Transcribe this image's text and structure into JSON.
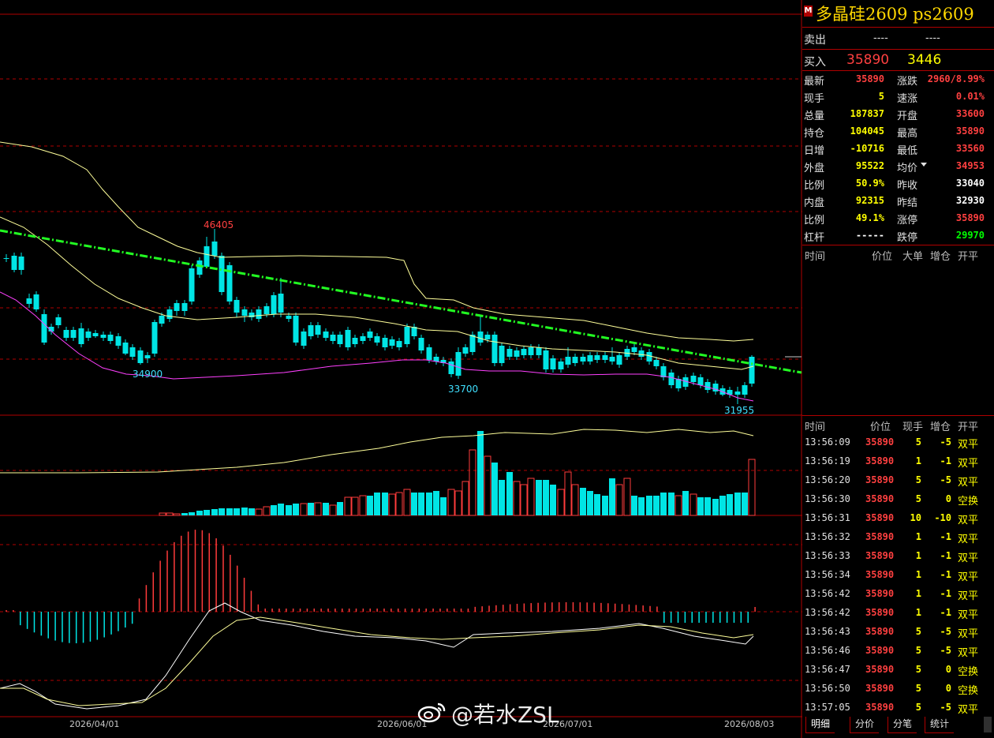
{
  "instrument": {
    "badge": "M",
    "title": "多晶硅2609  ps2609"
  },
  "orderbook": {
    "sell_label": "卖出",
    "sell_price": "----",
    "sell_vol": "----",
    "buy_label": "买入",
    "buy_price": "35890",
    "buy_vol": "3446"
  },
  "quote_left": [
    {
      "label": "最新",
      "value": "35890",
      "color": "#ff4040"
    },
    {
      "label": "现手",
      "value": "5",
      "color": "#ffff00"
    },
    {
      "label": "总量",
      "value": "187837",
      "color": "#ffff00"
    },
    {
      "label": "持仓",
      "value": "104045",
      "color": "#ffff00"
    },
    {
      "label": "日增",
      "value": "-10716",
      "color": "#ffff00"
    },
    {
      "label": "外盘",
      "value": "95522",
      "color": "#ffff00"
    },
    {
      "label": "比例",
      "value": "50.9%",
      "color": "#ffff00"
    },
    {
      "label": "内盘",
      "value": "92315",
      "color": "#ffff00"
    },
    {
      "label": "比例",
      "value": "49.1%",
      "color": "#ffff00"
    },
    {
      "label": "杠杆",
      "value": "-----",
      "color": "#ffffff"
    }
  ],
  "quote_right": [
    {
      "label": "涨跌",
      "value": "2960/8.99%",
      "color": "#ff4040"
    },
    {
      "label": "速涨",
      "value": "0.01%",
      "color": "#ff4040"
    },
    {
      "label": "开盘",
      "value": "33600",
      "color": "#ff4040"
    },
    {
      "label": "最高",
      "value": "35890",
      "color": "#ff4040"
    },
    {
      "label": "最低",
      "value": "33560",
      "color": "#ff4040"
    },
    {
      "label": "均价",
      "value": "34953",
      "color": "#ff4040"
    },
    {
      "label": "昨收",
      "value": "33040",
      "color": "#ffffff"
    },
    {
      "label": "昨结",
      "value": "32930",
      "color": "#ffffff"
    },
    {
      "label": "涨停",
      "value": "35890",
      "color": "#ff4040"
    },
    {
      "label": "跌停",
      "value": "29970",
      "color": "#00ff00"
    }
  ],
  "big_order_headers": [
    "时间",
    "价位",
    "大单",
    "增仓",
    "开平"
  ],
  "tick_headers": [
    "时间",
    "价位",
    "现手",
    "增仓",
    "开平"
  ],
  "ticks": [
    {
      "time": "13:56:09",
      "price": "35890",
      "vol": "5",
      "oi": "-5",
      "type": "双平"
    },
    {
      "time": "13:56:19",
      "price": "35890",
      "vol": "1",
      "oi": "-1",
      "type": "双平"
    },
    {
      "time": "13:56:20",
      "price": "35890",
      "vol": "5",
      "oi": "-5",
      "type": "双平"
    },
    {
      "time": "13:56:30",
      "price": "35890",
      "vol": "5",
      "oi": "0",
      "type": "空换"
    },
    {
      "time": "13:56:31",
      "price": "35890",
      "vol": "10",
      "oi": "-10",
      "type": "双平"
    },
    {
      "time": "13:56:32",
      "price": "35890",
      "vol": "1",
      "oi": "-1",
      "type": "双平"
    },
    {
      "time": "13:56:33",
      "price": "35890",
      "vol": "1",
      "oi": "-1",
      "type": "双平"
    },
    {
      "time": "13:56:34",
      "price": "35890",
      "vol": "1",
      "oi": "-1",
      "type": "双平"
    },
    {
      "time": "13:56:42",
      "price": "35890",
      "vol": "1",
      "oi": "-1",
      "type": "双平"
    },
    {
      "time": "13:56:42",
      "price": "35890",
      "vol": "1",
      "oi": "-1",
      "type": "双平"
    },
    {
      "time": "13:56:43",
      "price": "35890",
      "vol": "5",
      "oi": "-5",
      "type": "双平"
    },
    {
      "time": "13:56:46",
      "price": "35890",
      "vol": "5",
      "oi": "-5",
      "type": "双平"
    },
    {
      "time": "13:56:47",
      "price": "35890",
      "vol": "5",
      "oi": "0",
      "type": "空换"
    },
    {
      "time": "13:56:50",
      "price": "35890",
      "vol": "5",
      "oi": "0",
      "type": "空换"
    },
    {
      "time": "13:57:05",
      "price": "35890",
      "vol": "5",
      "oi": "-5",
      "type": "双平"
    }
  ],
  "tabs": [
    "明细",
    "分价",
    "分笔",
    "统计"
  ],
  "chart": {
    "price_labels": {
      "high": "46405",
      "low1": "34900",
      "low2": "33700",
      "low3": "31955"
    },
    "dates": [
      "2026/04/01",
      "2026/06/01",
      "2026/07/01",
      "2026/08/03"
    ],
    "colors": {
      "up": "#ff3b3b",
      "down": "#00e5e5",
      "trend": "#22ff22",
      "ma": "#ffff9a",
      "lower_band": "#ff40ff",
      "grid": "#b00000"
    }
  },
  "watermark": "@若水ZSL"
}
